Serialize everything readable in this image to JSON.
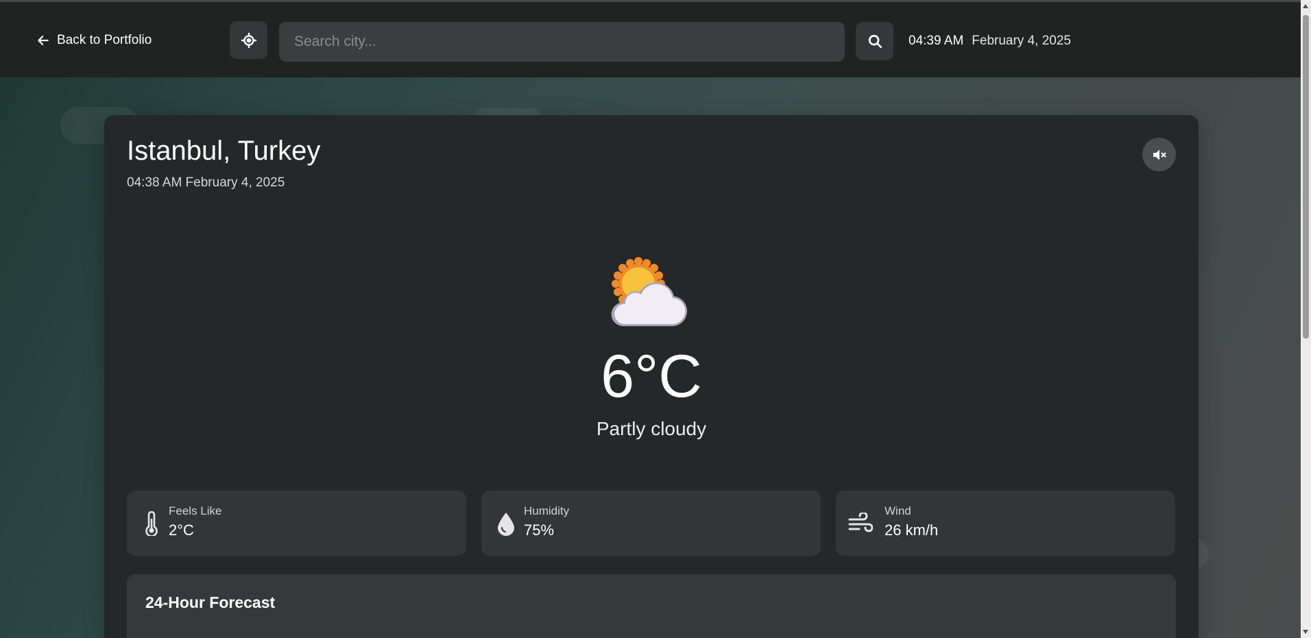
{
  "header": {
    "back_label": "Back to Portfolio",
    "search_placeholder": "Search city...",
    "time": "04:39 AM",
    "date": "February 4, 2025"
  },
  "weather": {
    "location": "Istanbul, Turkey",
    "datetime": "04:38 AM February 4, 2025",
    "icon": "partly-cloudy-icon",
    "temperature": "6°C",
    "condition": "Partly cloudy"
  },
  "stats": [
    {
      "label": "Feels Like",
      "value": "2°C",
      "icon": "thermometer-icon"
    },
    {
      "label": "Humidity",
      "value": "75%",
      "icon": "droplet-icon"
    },
    {
      "label": "Wind",
      "value": "26 km/h",
      "icon": "wind-icon"
    }
  ],
  "forecast": {
    "title": "24-Hour Forecast"
  },
  "controls": {
    "mute_icon": "volume-mute-icon"
  },
  "colors": {
    "topbar": "#202322",
    "card": "#242828",
    "stat_card": "#333636",
    "sun": "#f5b731",
    "cloud": "#f1ecf6"
  }
}
